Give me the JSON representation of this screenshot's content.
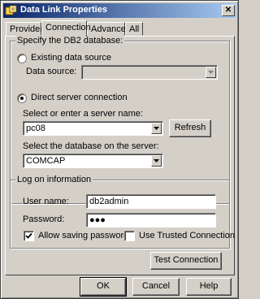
{
  "window": {
    "title": "Data Link Properties",
    "close_glyph": "✕"
  },
  "tabs": [
    {
      "label": "Provider"
    },
    {
      "label": "Connection"
    },
    {
      "label": "Advanced"
    },
    {
      "label": "All"
    }
  ],
  "db_group": {
    "label": "Specify the DB2 database:",
    "existing_source_label": "Existing data source",
    "data_source_label": "Data source:",
    "data_source_value": "",
    "direct_connection_label": "Direct server connection",
    "server_prompt": "Select or enter a server name:",
    "server_value": "pc08",
    "refresh_label": "Refresh",
    "database_prompt": "Select the database on the server:",
    "database_value": "COMCAP"
  },
  "logon_group": {
    "label": "Log on information",
    "username_label": "User name:",
    "username_value": "db2admin",
    "password_label": "Password:",
    "password_value": "●●●",
    "allow_saving_label": "Allow saving password",
    "allow_saving_checked": true,
    "trusted_label": "Use Trusted Connection",
    "trusted_checked": false
  },
  "test_connection_label": "Test Connection",
  "footer": {
    "ok_label": "OK",
    "cancel_label": "Cancel",
    "help_label": "Help"
  }
}
